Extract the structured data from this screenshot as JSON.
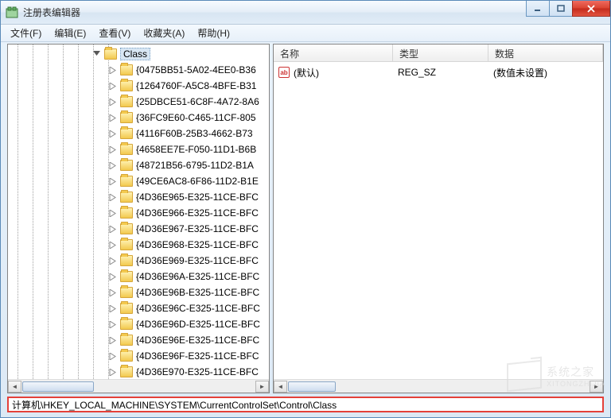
{
  "title": "注册表编辑器",
  "menu": [
    "文件(F)",
    "编辑(E)",
    "查看(V)",
    "收藏夹(A)",
    "帮助(H)"
  ],
  "tree": {
    "parent": "Class",
    "children": [
      "{0475BB51-5A02-4EE0-B36",
      "{1264760F-A5C8-4BFE-B31",
      "{25DBCE51-6C8F-4A72-8A6",
      "{36FC9E60-C465-11CF-805",
      "{4116F60B-25B3-4662-B73",
      "{4658EE7E-F050-11D1-B6B",
      "{48721B56-6795-11D2-B1A",
      "{49CE6AC8-6F86-11D2-B1E",
      "{4D36E965-E325-11CE-BFC",
      "{4D36E966-E325-11CE-BFC",
      "{4D36E967-E325-11CE-BFC",
      "{4D36E968-E325-11CE-BFC",
      "{4D36E969-E325-11CE-BFC",
      "{4D36E96A-E325-11CE-BFC",
      "{4D36E96B-E325-11CE-BFC",
      "{4D36E96C-E325-11CE-BFC",
      "{4D36E96D-E325-11CE-BFC",
      "{4D36E96E-E325-11CE-BFC",
      "{4D36E96F-E325-11CE-BFC",
      "{4D36E970-E325-11CE-BFC"
    ]
  },
  "list": {
    "cols": {
      "name": "名称",
      "type": "类型",
      "data": "数据"
    },
    "rows": [
      {
        "name": "(默认)",
        "type": "REG_SZ",
        "data": "(数值未设置)"
      }
    ]
  },
  "status_path": "计算机\\HKEY_LOCAL_MACHINE\\SYSTEM\\CurrentControlSet\\Control\\Class",
  "watermark": {
    "line1": "系统之家",
    "line2": "XITONGZHIJIA"
  }
}
